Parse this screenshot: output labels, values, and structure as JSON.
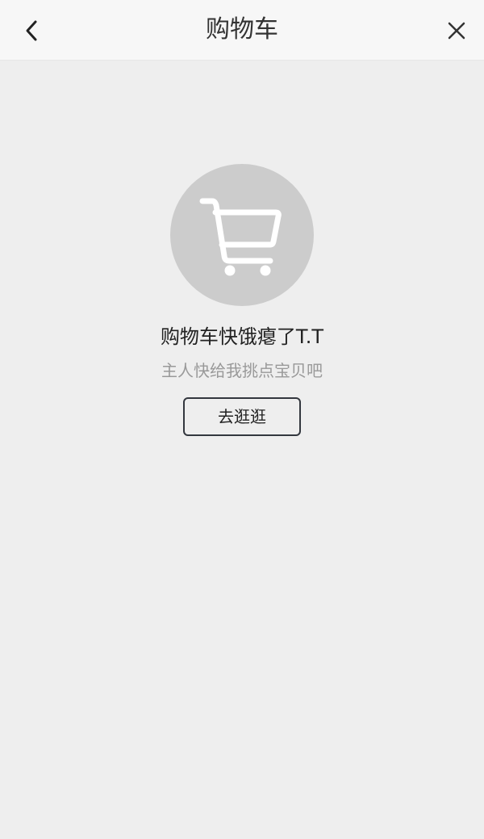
{
  "header": {
    "title": "购物车",
    "back_icon": "chevron-left-icon",
    "close_icon": "close-icon"
  },
  "empty_state": {
    "icon": "shopping-cart-icon",
    "title": "购物车快饿瘪了T.T",
    "subtitle": "主人快给我挑点宝贝吧",
    "button_label": "去逛逛"
  },
  "colors": {
    "background": "#eeeeee",
    "header_background": "#f7f7f7",
    "icon_circle": "#cccccc",
    "button_border": "#33373e",
    "subtitle_text": "#999999"
  }
}
